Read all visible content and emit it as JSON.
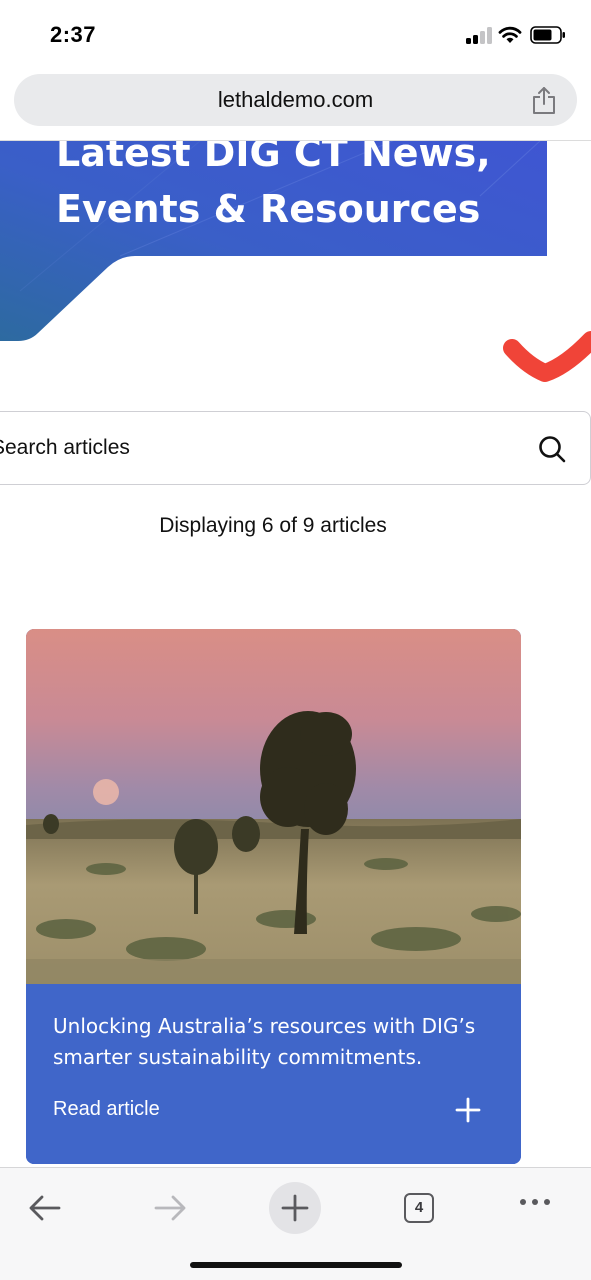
{
  "status_bar": {
    "time": "2:37"
  },
  "browser": {
    "url": "lethaldemo.com",
    "open_tabs": "4"
  },
  "hero": {
    "title_line1": "Latest DIG CT News,",
    "title_line2": "Events & Resources"
  },
  "search": {
    "placeholder": "Search articles"
  },
  "results": {
    "count_text": "Displaying 6 of 9 articles"
  },
  "article": {
    "title": "Unlocking Australia’s resources with DIG’s smarter sustainability commitments.",
    "link_label": "Read article"
  },
  "colors": {
    "hero_blue": "#3d5fce",
    "card_blue": "#4066c9",
    "check_red": "#f04438"
  },
  "icons": [
    "signal-icon",
    "wifi-icon",
    "battery-icon",
    "share-icon",
    "search-icon",
    "plus-icon",
    "back-arrow-icon",
    "forward-arrow-icon",
    "new-tab-icon",
    "tabs-icon",
    "more-icon"
  ]
}
